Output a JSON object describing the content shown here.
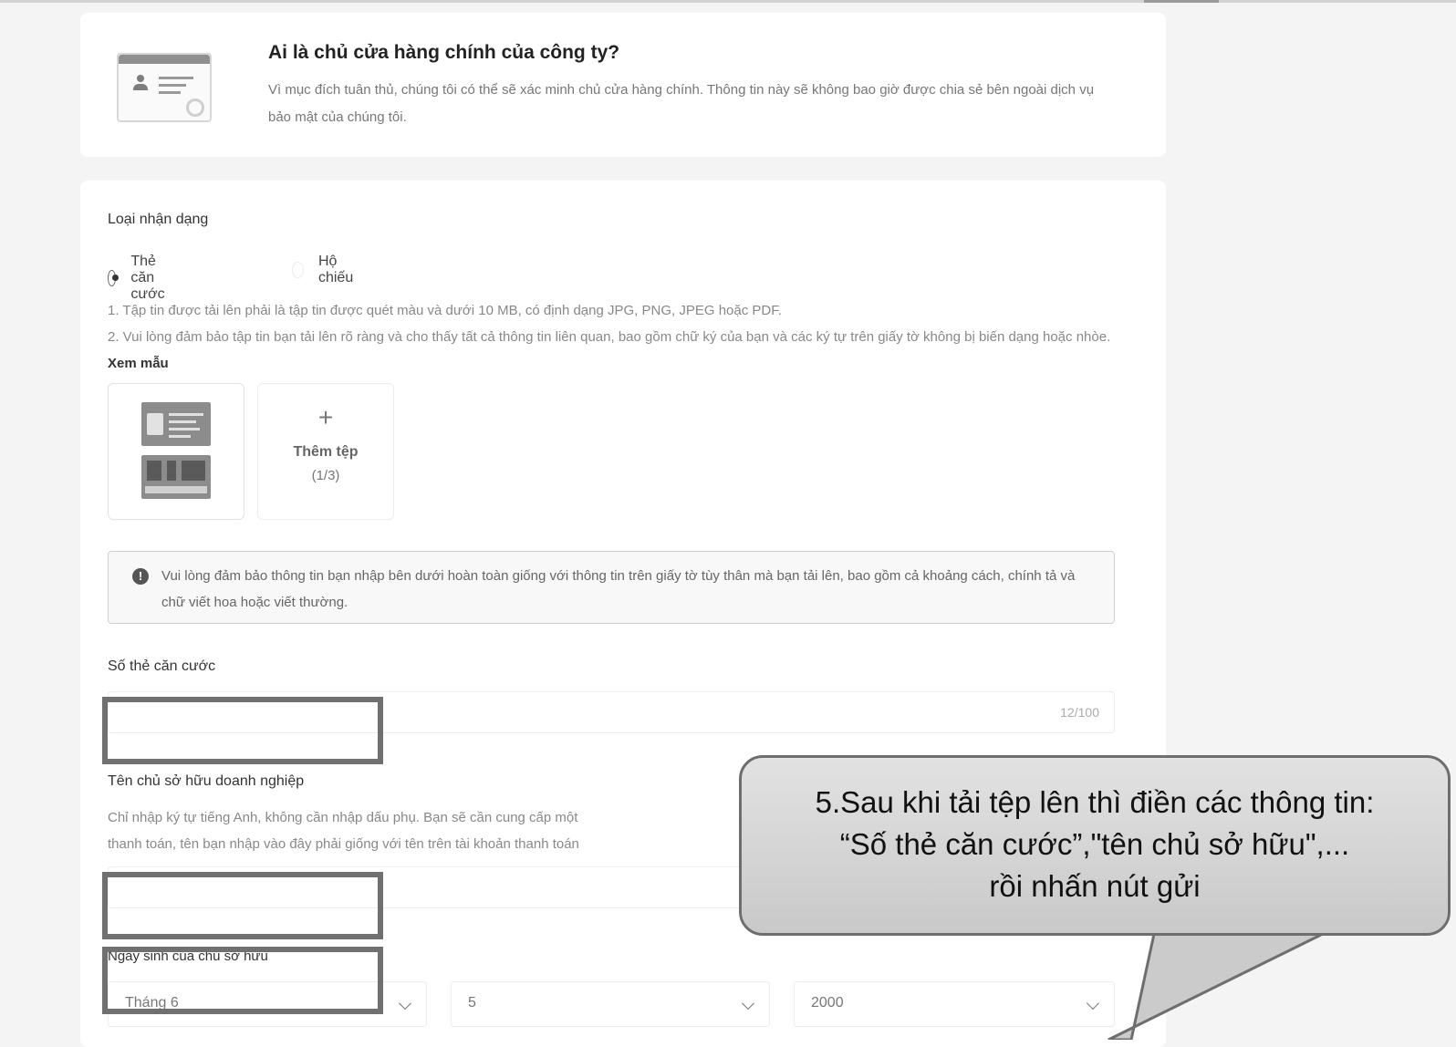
{
  "header": {
    "title": "Ai là chủ cửa hàng chính của công ty?",
    "description": "Vì mục đích tuân thủ, chúng tôi có thể sẽ xác minh chủ cửa hàng chính. Thông tin này sẽ không bao giờ được chia sẻ bên ngoài dịch vụ bảo mật của chúng tôi."
  },
  "id_type": {
    "label": "Loại nhận dạng",
    "options": [
      "Thẻ căn cước",
      "Hộ chiếu"
    ],
    "selected": "Thẻ căn cước"
  },
  "rules": {
    "line1": "1. Tập tin được tải lên phải là tập tin được quét màu và dưới 10 MB, có định dạng JPG, PNG, JPEG hoặc PDF.",
    "line2": "2. Vui lòng đảm bảo tập tin bạn tải lên rõ ràng và cho thấy tất cả thông tin liên quan, bao gồm chữ ký của bạn và các ký tự trên giấy tờ không bị biến dạng hoặc nhòe.",
    "sample_link": "Xem mẫu"
  },
  "upload": {
    "add_label": "Thêm tệp",
    "count": "(1/3)"
  },
  "notice": {
    "text": "Vui lòng đảm bảo thông tin bạn nhập bên dưới hoàn toàn giống với thông tin trên giấy tờ tùy thân mà bạn tải lên, bao gồm cả khoảng cách, chính tả và chữ viết hoa hoặc viết thường."
  },
  "id_number": {
    "label": "Số thẻ căn cước",
    "counter": "12/100"
  },
  "owner_name": {
    "label": "Tên chủ sở hữu doanh nghiệp",
    "hint": "Chỉ nhập ký tự tiếng Anh, không cần nhập dấu phụ. Bạn sẽ cần cung cấp một",
    "hint2": "thanh toán, tên bạn nhập vào đây phải giống với tên trên tài khoản thanh toán"
  },
  "dob": {
    "label": "Ngày sinh của chủ sở hữu",
    "month": "Tháng 6",
    "day": "5",
    "year": "2000"
  },
  "callout": {
    "line1": "5.Sau khi tải tệp lên thì điền các thông tin:",
    "line2": "“Số thẻ căn cước”,\"tên chủ sở hữu\",...",
    "line3": "rồi nhấn nút gửi"
  }
}
